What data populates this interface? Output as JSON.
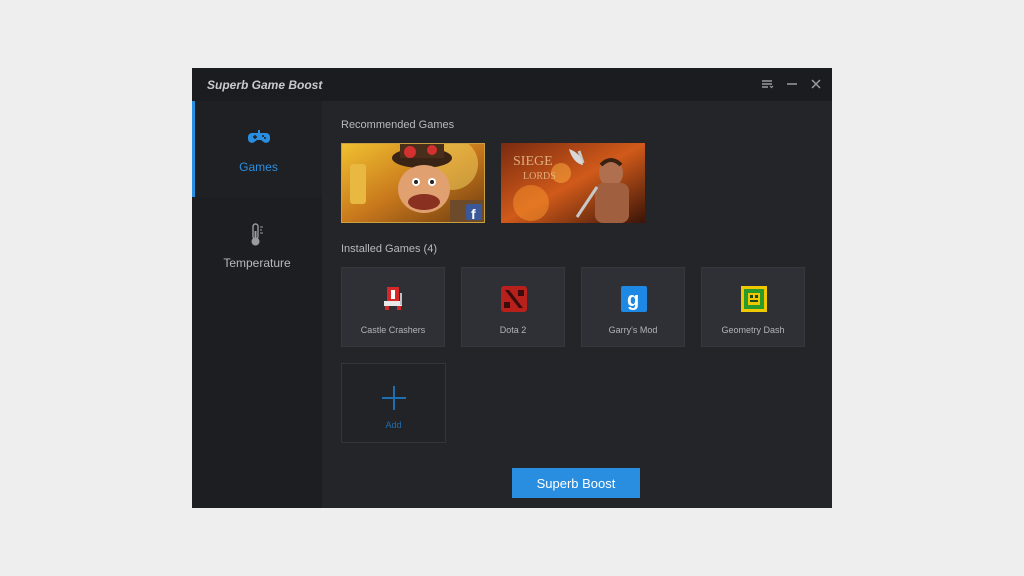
{
  "window": {
    "title": "Superb Game Boost"
  },
  "titlebar_icons": [
    "menu-icon",
    "minimize-icon",
    "close-icon"
  ],
  "sidebar": {
    "items": [
      {
        "label": "Games",
        "icon": "gamepad-icon",
        "active": true
      },
      {
        "label": "Temperature",
        "icon": "thermometer-icon",
        "active": false
      }
    ]
  },
  "main": {
    "recommended_title": "Recommended Games",
    "installed_title": "Installed Games (4)",
    "installed_games": [
      {
        "name": "Castle Crashers",
        "icon": "castle-crashers-icon"
      },
      {
        "name": "Dota 2",
        "icon": "dota2-icon"
      },
      {
        "name": "Garry's Mod",
        "icon": "garrys-mod-icon"
      },
      {
        "name": "Geometry Dash",
        "icon": "geometry-dash-icon"
      }
    ],
    "add_label": "Add",
    "boost_label": "Superb Boost"
  },
  "colors": {
    "accent": "#2a8ee0",
    "window_bg": "#242529",
    "sidebar_bg": "#1d1e21"
  }
}
